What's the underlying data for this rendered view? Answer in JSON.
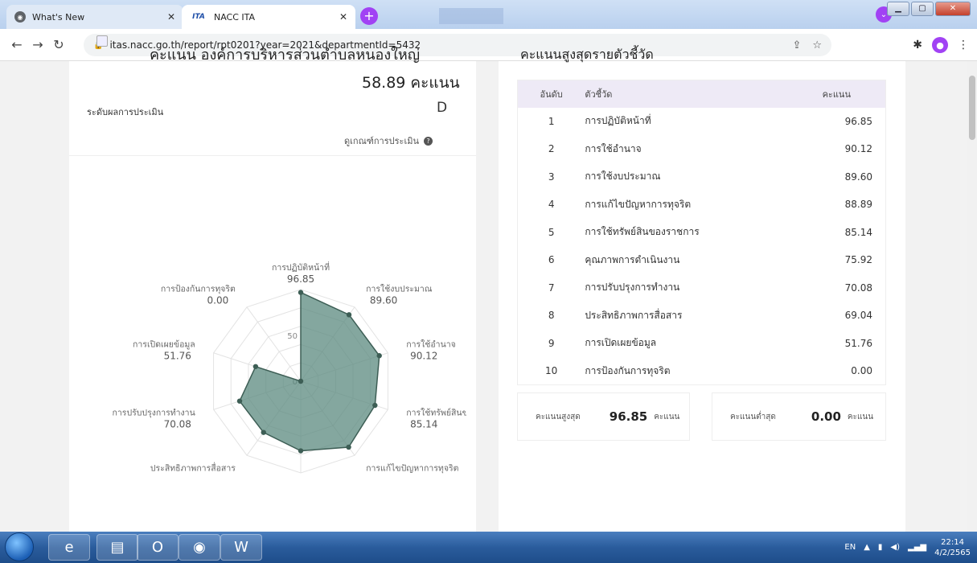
{
  "browser": {
    "tabs": [
      {
        "title": "What's New",
        "favicon": "chrome-icon",
        "active": false
      },
      {
        "title": "NACC ITA",
        "favicon": "ita-logo",
        "active": true
      }
    ],
    "url": "itas.nacc.go.th/report/rpt0201?year=2021&departmentId=5432",
    "favicon_text": "ITA"
  },
  "score_card": {
    "title": "คะแนน องค์การบริหารส่วนตำบลหนองใหญ่",
    "total_score": "58.89 คะแนน",
    "level_label": "ระดับผลการประเมิน",
    "level_grade": "D",
    "criteria_link": "ดูเกณฑ์การประเมิน"
  },
  "chart_data": {
    "type": "radar",
    "range": [
      0,
      100
    ],
    "tick_labels": [
      "0",
      "50"
    ],
    "axes": [
      {
        "label": "การปฏิบัติหน้าที่",
        "value": 96.85,
        "value_label": "96.85"
      },
      {
        "label": "การใช้งบประมาณ",
        "value": 89.6,
        "value_label": "89.60"
      },
      {
        "label": "การใช้อำนาจ",
        "value": 90.12,
        "value_label": "90.12"
      },
      {
        "label": "การใช้ทรัพย์สินข",
        "value": 85.14,
        "value_label": "85.14"
      },
      {
        "label": "การแก้ไขปัญหาการทุจริต",
        "value": 88.89,
        "value_label": "88.89"
      },
      {
        "label": "คุณภาพการดำเนินงาน",
        "value": 75.92,
        "value_label": "75.92"
      },
      {
        "label": "ประสิทธิภาพการสื่อสาร",
        "value": 69.04,
        "value_label": "69.04"
      },
      {
        "label": "การปรับปรุงการทำงาน",
        "value": 70.08,
        "value_label": "70.08"
      },
      {
        "label": "การเปิดเผยข้อมูล",
        "value": 51.76,
        "value_label": "51.76"
      },
      {
        "label": "การป้องกันการทุจริต",
        "value": 0.0,
        "value_label": "0.00"
      }
    ],
    "fill_color": "#5b8a7f",
    "stroke_color": "#3d5e55"
  },
  "ranking": {
    "title": "คะแนนสูงสุดรายตัวชี้วัด",
    "headers": {
      "rank": "อันดับ",
      "indicator": "ตัวชี้วัด",
      "score": "คะแนน"
    },
    "rows": [
      {
        "rank": "1",
        "name": "การปฏิบัติหน้าที่",
        "score": "96.85"
      },
      {
        "rank": "2",
        "name": "การใช้อำนาจ",
        "score": "90.12"
      },
      {
        "rank": "3",
        "name": "การใช้งบประมาณ",
        "score": "89.60"
      },
      {
        "rank": "4",
        "name": "การแก้ไขปัญหาการทุจริต",
        "score": "88.89"
      },
      {
        "rank": "5",
        "name": "การใช้ทรัพย์สินของราชการ",
        "score": "85.14"
      },
      {
        "rank": "6",
        "name": "คุณภาพการดำเนินงาน",
        "score": "75.92"
      },
      {
        "rank": "7",
        "name": "การปรับปรุงการทำงาน",
        "score": "70.08"
      },
      {
        "rank": "8",
        "name": "ประสิทธิภาพการสื่อสาร",
        "score": "69.04"
      },
      {
        "rank": "9",
        "name": "การเปิดเผยข้อมูล",
        "score": "51.76"
      },
      {
        "rank": "10",
        "name": "การป้องกันการทุจริต",
        "score": "0.00"
      }
    ],
    "max": {
      "label": "คะแนนสูงสุด",
      "value": "96.85",
      "unit": "คะแนน"
    },
    "min": {
      "label": "คะแนนต่ำสุด",
      "value": "0.00",
      "unit": "คะแนน"
    }
  },
  "taskbar": {
    "language": "EN",
    "time": "22:14",
    "date": "4/2/2565"
  }
}
